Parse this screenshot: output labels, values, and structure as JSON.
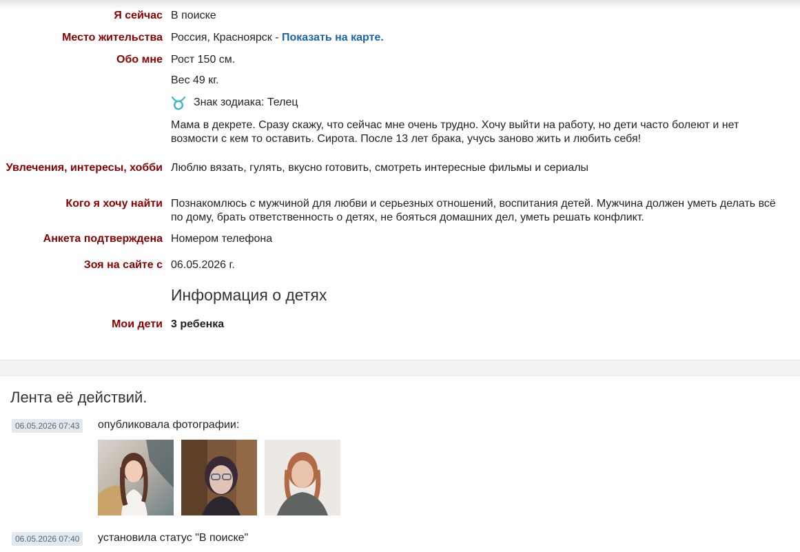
{
  "profile": {
    "status": {
      "label": "Я сейчас",
      "value": "В поиске"
    },
    "location": {
      "label": "Место жительства",
      "value": "Россия, Красноярск -",
      "map_link": "Показать на карте."
    },
    "about": {
      "label": "Обо мне",
      "height": "Рост 150 см.",
      "weight": "Вес 49 кг.",
      "zodiac": "Знак зодиака: Телец",
      "zodiac_icon": "taurus-icon",
      "text": "Мама в декрете. Сразу скажу, что сейчас мне очень трудно. Хочу выйти на работу, но дети часто болеют и нет возмости с кем то оставить. Сирота. После 13 лет брака, учусь заново жить и любить себя!"
    },
    "hobbies": {
      "label": "Увлечения, интересы, хобби",
      "value": "Люблю вязать, гулять, вкусно готовить, смотреть интересные фильмы и сериалы"
    },
    "looking_for": {
      "label": "Кого я хочу найти",
      "value": "Познакомлюсь с мужчиной для любви и серьезных отношений, воспитания детей. Мужчина должен уметь делать всё по дому, брать ответственность о детях, не бояться домашних дел, уметь решать конфликт."
    },
    "verified": {
      "label": "Анкета подтверждена",
      "value": "Номером телефона"
    },
    "member_since": {
      "label": "Зоя на сайте с",
      "value": "06.05.2026 г."
    },
    "children_section_title": "Информация о детях",
    "children": {
      "label": "Мои дети",
      "value": "3 ребенка"
    }
  },
  "feed": {
    "title": "Лента её действий.",
    "items": [
      {
        "timestamp": "06.05.2026 07:43",
        "text": "опубликовала фотографии:"
      },
      {
        "timestamp": "06.05.2026 07:40",
        "text": "установила статус \"В поиске\""
      }
    ]
  },
  "colors": {
    "label": "#8b0000",
    "link": "#1a63b0",
    "zodiac": "#3bb8c4",
    "timestamp_bg": "#e1e8ee"
  }
}
